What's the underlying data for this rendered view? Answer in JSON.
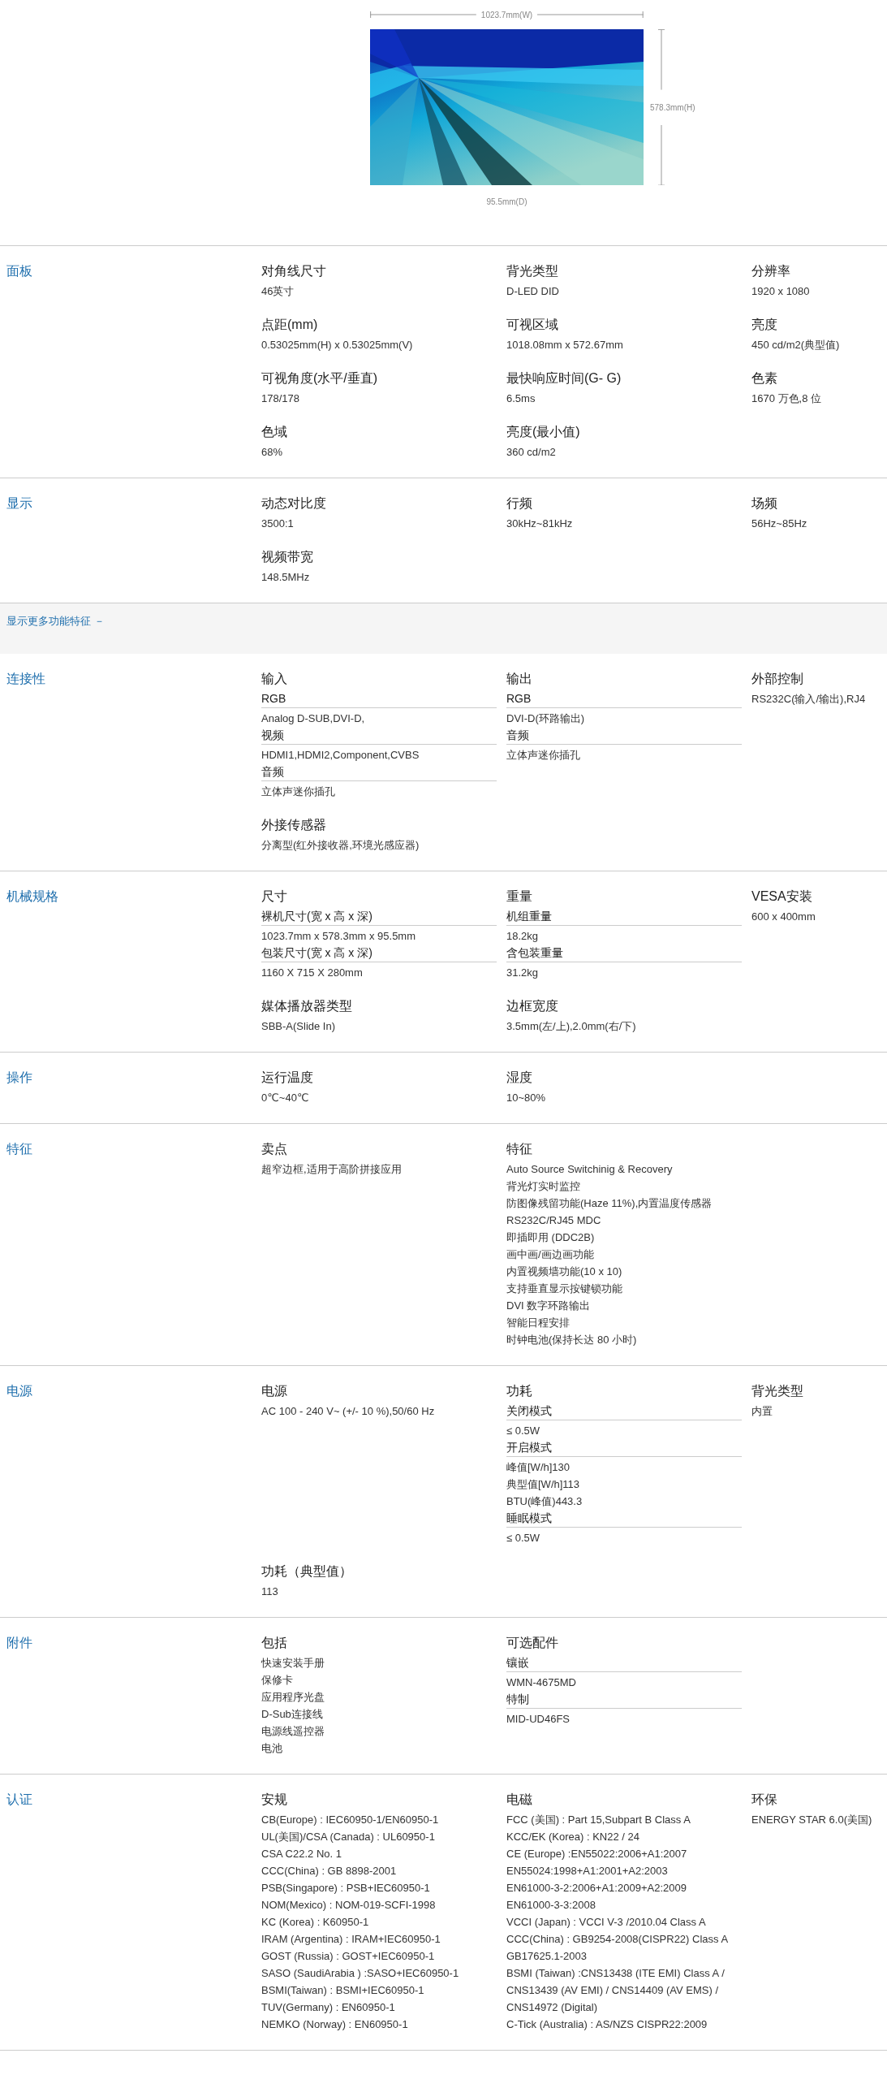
{
  "dimensions": {
    "width": "1023.7mm(W)",
    "height": "578.3mm(H)",
    "depth": "95.5mm(D)"
  },
  "sections": [
    {
      "label": "面板",
      "items": [
        {
          "kind": "plain",
          "title": "对角线尺寸",
          "lines": [
            "46英寸"
          ]
        },
        {
          "kind": "plain",
          "title": "背光类型",
          "lines": [
            "D-LED DID"
          ]
        },
        {
          "kind": "plain",
          "title": "分辨率",
          "lines": [
            "1920 x 1080"
          ]
        },
        {
          "kind": "plain",
          "title": "点距(mm)",
          "lines": [
            "0.53025mm(H) x 0.53025mm(V)"
          ]
        },
        {
          "kind": "plain",
          "title": "可视区域",
          "lines": [
            "1018.08mm x 572.67mm"
          ]
        },
        {
          "kind": "plain",
          "title": "亮度",
          "lines": [
            "450 cd/m2(典型值)"
          ]
        },
        {
          "kind": "plain",
          "title": "可视角度(水平/垂直)",
          "lines": [
            "178/178"
          ]
        },
        {
          "kind": "plain",
          "title": "最快响应时间(G- G)",
          "lines": [
            "6.5ms"
          ]
        },
        {
          "kind": "plain",
          "title": "色素",
          "lines": [
            "1670 万色,8 位"
          ]
        },
        {
          "kind": "plain",
          "title": "色域",
          "lines": [
            "68%"
          ]
        },
        {
          "kind": "plain",
          "title": "亮度(最小值)",
          "lines": [
            "360 cd/m2"
          ]
        }
      ]
    },
    {
      "label": "显示",
      "items": [
        {
          "kind": "plain",
          "title": "动态对比度",
          "lines": [
            "3500:1"
          ]
        },
        {
          "kind": "plain",
          "title": "行频",
          "lines": [
            "30kHz~81kHz"
          ]
        },
        {
          "kind": "plain",
          "title": "场频",
          "lines": [
            "56Hz~85Hz"
          ]
        },
        {
          "kind": "plain",
          "title": "视频带宽",
          "lines": [
            "148.5MHz"
          ]
        }
      ]
    }
  ],
  "more_toggle": "显示更多功能特征 －",
  "more_sections": [
    {
      "label": "连接性",
      "items": [
        {
          "kind": "grouped",
          "title": "输入",
          "groups": [
            {
              "label": "RGB",
              "lines": [
                "Analog D-SUB,DVI-D,"
              ]
            },
            {
              "label": "视频",
              "lines": [
                "HDMI1,HDMI2,Component,CVBS"
              ]
            },
            {
              "label": "音频",
              "lines": [
                "立体声迷你插孔"
              ]
            }
          ]
        },
        {
          "kind": "grouped",
          "title": "输出",
          "groups": [
            {
              "label": "RGB",
              "lines": [
                "DVI-D(环路输出)"
              ]
            },
            {
              "label": "音频",
              "lines": [
                "立体声迷你插孔"
              ]
            }
          ]
        },
        {
          "kind": "plain",
          "title": "外部控制",
          "lines": [
            "RS232C(输入/输出),RJ4"
          ]
        },
        {
          "kind": "plain",
          "title": "外接传感器",
          "lines": [
            "分离型(红外接收器,环境光感应器)"
          ]
        }
      ]
    },
    {
      "label": "机械规格",
      "items": [
        {
          "kind": "grouped",
          "title": "尺寸",
          "groups": [
            {
              "label": "裸机尺寸(宽 x 高 x 深)",
              "lines": [
                "1023.7mm x 578.3mm x 95.5mm"
              ]
            },
            {
              "label": "包装尺寸(宽 x 高 x 深)",
              "lines": [
                "1160 X 715 X 280mm"
              ]
            }
          ]
        },
        {
          "kind": "grouped",
          "title": "重量",
          "groups": [
            {
              "label": "机组重量",
              "lines": [
                "18.2kg"
              ]
            },
            {
              "label": "含包装重量",
              "lines": [
                "31.2kg"
              ]
            }
          ]
        },
        {
          "kind": "plain",
          "title": "VESA安装",
          "lines": [
            "600 x 400mm"
          ]
        },
        {
          "kind": "plain",
          "title": "媒体播放器类型",
          "lines": [
            "SBB-A(Slide In)"
          ]
        },
        {
          "kind": "plain",
          "title": "边框宽度",
          "lines": [
            "3.5mm(左/上),2.0mm(右/下)"
          ]
        }
      ]
    },
    {
      "label": "操作",
      "items": [
        {
          "kind": "plain",
          "title": "运行温度",
          "lines": [
            "0℃~40℃"
          ]
        },
        {
          "kind": "plain",
          "title": "湿度",
          "lines": [
            "10~80%"
          ]
        }
      ]
    },
    {
      "label": "特征",
      "items": [
        {
          "kind": "plain",
          "title": "卖点",
          "lines": [
            "超窄边框,适用于高阶拼接应用"
          ]
        },
        {
          "kind": "plain",
          "title": "特征",
          "lines": [
            "Auto Source Switchinig & Recovery",
            "背光灯实时监控",
            "防图像残留功能(Haze 11%),内置温度传感器",
            "RS232C/RJ45 MDC",
            "即插即用 (DDC2B)",
            "画中画/画边画功能",
            "内置视频墙功能(10 x 10)",
            "支持垂直显示按键锁功能",
            "DVI 数字环路输出",
            "智能日程安排",
            "时钟电池(保持长达 80 小时)"
          ]
        }
      ]
    },
    {
      "label": "电源",
      "items": [
        {
          "kind": "plain",
          "title": "电源",
          "lines": [
            "AC 100 - 240 V~ (+/- 10 %),50/60 Hz"
          ]
        },
        {
          "kind": "grouped",
          "title": "功耗",
          "groups": [
            {
              "label": "关闭模式",
              "lines": [
                "≤ 0.5W"
              ]
            },
            {
              "label": "开启模式",
              "lines": [
                "峰值[W/h]130",
                "典型值[W/h]113",
                "BTU(峰值)443.3"
              ]
            },
            {
              "label": "睡眠模式",
              "lines": [
                "≤ 0.5W"
              ]
            }
          ]
        },
        {
          "kind": "plain",
          "title": "背光类型",
          "lines": [
            "内置"
          ]
        },
        {
          "kind": "plain",
          "title": "功耗（典型值）",
          "lines": [
            "113"
          ]
        }
      ]
    },
    {
      "label": "附件",
      "items": [
        {
          "kind": "plain",
          "title": "包括",
          "lines": [
            "快速安装手册",
            "保修卡",
            "应用程序光盘",
            "D-Sub连接线",
            "电源线遥控器",
            "电池"
          ]
        },
        {
          "kind": "grouped",
          "title": "可选配件",
          "groups": [
            {
              "label": "镶嵌",
              "lines": [
                "WMN-4675MD"
              ]
            },
            {
              "label": "特制",
              "lines": [
                "MID-UD46FS"
              ]
            }
          ]
        }
      ]
    },
    {
      "label": "认证",
      "items": [
        {
          "kind": "plain",
          "title": "安规",
          "lines": [
            "CB(Europe) : IEC60950-1/EN60950-1",
            "UL(美国)/CSA (Canada) : UL60950-1",
            "CSA C22.2 No. 1",
            "CCC(China) : GB 8898-2001",
            "PSB(Singapore) : PSB+IEC60950-1",
            "NOM(Mexico) : NOM-019-SCFI-1998",
            "KC (Korea) : K60950-1",
            "IRAM (Argentina) : IRAM+IEC60950-1",
            "GOST (Russia) : GOST+IEC60950-1",
            "SASO (SaudiArabia ) :SASO+IEC60950-1",
            "BSMI(Taiwan) : BSMI+IEC60950-1",
            "TUV(Germany) : EN60950-1",
            "NEMKO (Norway) : EN60950-1"
          ]
        },
        {
          "kind": "plain",
          "title": "电磁",
          "lines": [
            "FCC (美国) : Part 15,Subpart B Class A",
            "KCC/EK (Korea) : KN22 / 24",
            "CE (Europe) :EN55022:2006+A1:2007",
            "EN55024:1998+A1:2001+A2:2003",
            "EN61000-3-2:2006+A1:2009+A2:2009",
            "EN61000-3-3:2008",
            "VCCI (Japan) : VCCI V-3 /2010.04 Class A",
            "CCC(China) : GB9254-2008(CISPR22) Class A",
            "GB17625.1-2003",
            "BSMI (Taiwan) :CNS13438 (ITE EMI) Class A / CNS13439 (AV EMI) / CNS14409 (AV EMS) / CNS14972 (Digital)",
            "C-Tick (Australia) : AS/NZS CISPR22:2009"
          ]
        },
        {
          "kind": "plain",
          "title": "环保",
          "lines": [
            "ENERGY STAR 6.0(美国)"
          ]
        }
      ]
    }
  ]
}
